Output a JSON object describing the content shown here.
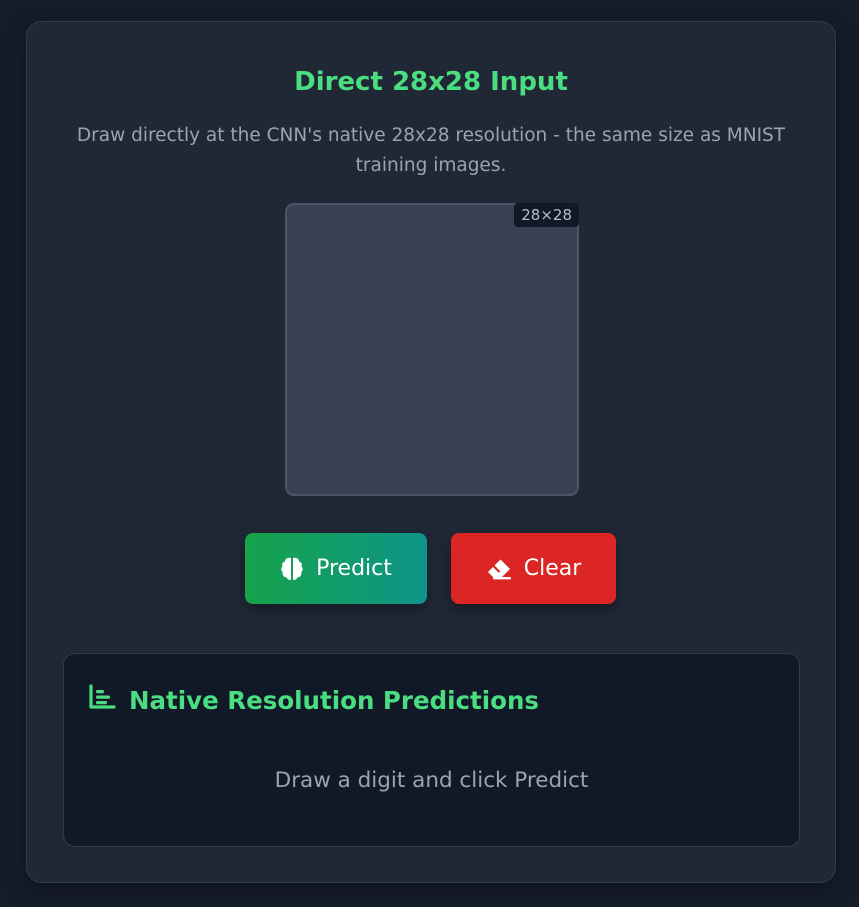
{
  "panel": {
    "title": "Direct 28x28 Input",
    "subtitle": "Draw directly at the CNN's native 28x28 resolution - the same size as MNIST training images."
  },
  "canvas": {
    "badge": "28×28"
  },
  "buttons": {
    "predict_label": "Predict",
    "predict_icon": "brain-icon",
    "clear_label": "Clear",
    "clear_icon": "eraser-icon"
  },
  "results": {
    "title": "Native Resolution Predictions",
    "title_icon": "bar-chart-icon",
    "empty_message": "Draw a digit and click Predict"
  },
  "colors": {
    "accent": "#4ade80",
    "predict_gradient_start": "#16a34a",
    "predict_gradient_end": "#0d9488",
    "clear": "#dc2626",
    "background": "#161d2a",
    "card": "#202836",
    "canvas": "#394253"
  }
}
